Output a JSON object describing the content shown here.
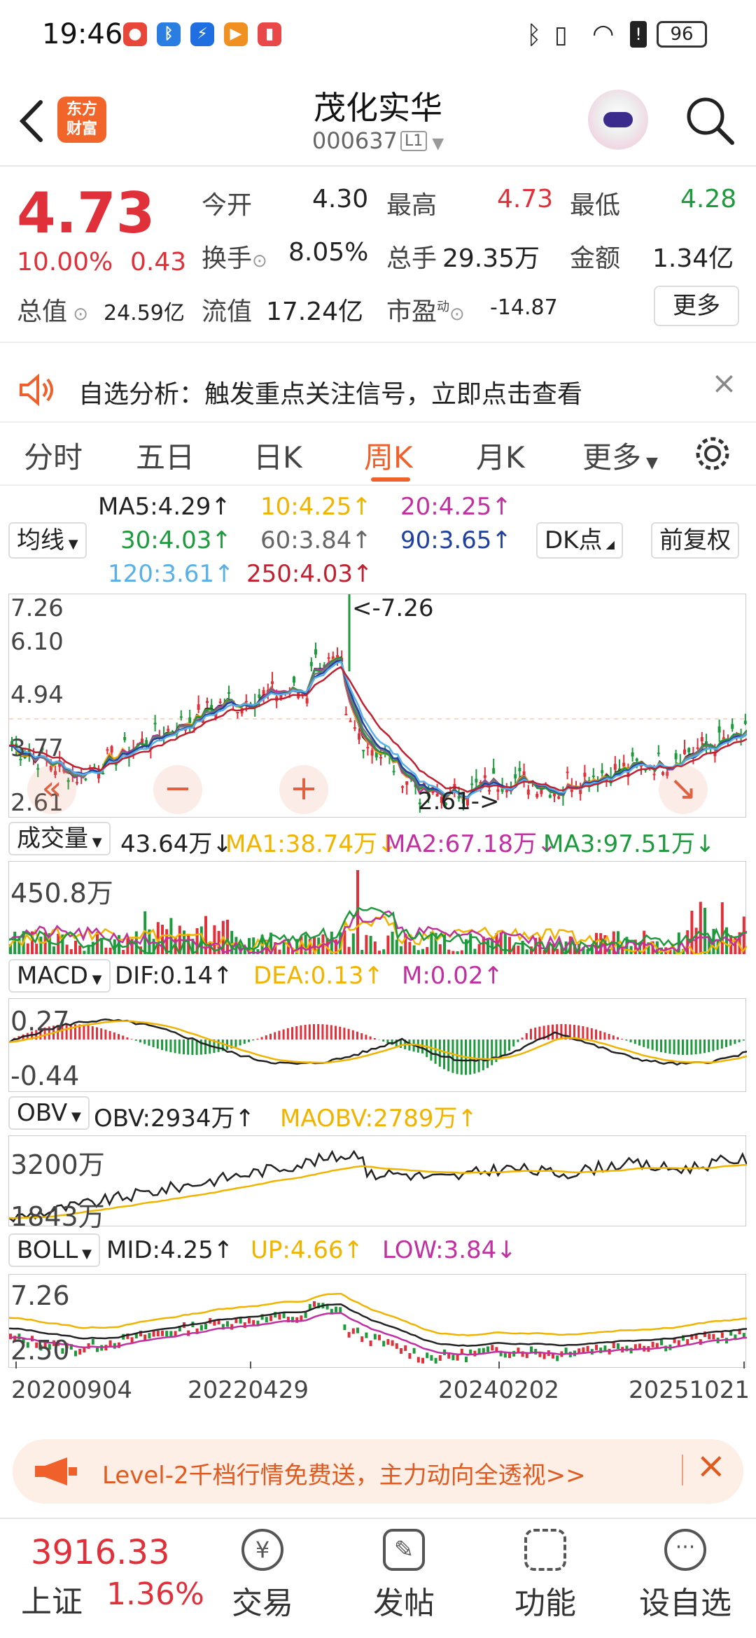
{
  "status": {
    "time": "19:46",
    "battery": "96"
  },
  "header": {
    "title": "茂化实华",
    "code": "000637",
    "badge": "L1",
    "logo_line1": "东方",
    "logo_line2": "财富"
  },
  "quote": {
    "price": "4.73",
    "change_pct": "10.00%",
    "change": "0.43",
    "open_label": "今开",
    "open": "4.30",
    "high_label": "最高",
    "high": "4.73",
    "low_label": "最低",
    "low": "4.28",
    "turnover_label": "换手",
    "turnover": "8.05%",
    "volume_label": "总手",
    "volume": "29.35万",
    "amount_label": "金额",
    "amount": "1.34亿",
    "mktcap_label": "总值",
    "mktcap": "24.59亿",
    "float_label": "流值",
    "float": "17.24亿",
    "pe_label": "市盈",
    "pe_sup": "动",
    "pe": "-14.87",
    "more": "更多"
  },
  "notice": {
    "text": "自选分析：触发重点关注信号，立即点击查看"
  },
  "tabs": [
    "分时",
    "五日",
    "日K",
    "周K",
    "月K",
    "更多"
  ],
  "colors": {
    "up": "#e0303a",
    "down": "#1d9a3b",
    "accent": "#f0602a",
    "ma5": "#222222",
    "ma10": "#f0b400",
    "ma20": "#c030a0",
    "ma30": "#1d9a3b",
    "ma60": "#777777",
    "ma90": "#2040a0",
    "ma120": "#58b0e8",
    "ma250": "#c02030"
  },
  "ma_controls": {
    "select": "均线",
    "dk": "DK点",
    "fq": "前复权"
  },
  "ma": {
    "ma5": "MA5:4.29↑",
    "ma10": "10:4.25↑",
    "ma20": "20:4.25↑",
    "ma30": "30:4.03↑",
    "ma60": "60:3.84↑",
    "ma90": "90:3.65↑",
    "ma120": "120:3.61↑",
    "ma250": "250:4.03↑"
  },
  "main_chart": {
    "y_ticks": [
      "7.26",
      "6.10",
      "4.94",
      "3.77",
      "2.61"
    ],
    "high_note": "<-7.26",
    "low_note": "2.61->"
  },
  "volume_panel": {
    "select": "成交量",
    "value": "43.64万↓",
    "ma1": "MA1:38.74万↓",
    "ma2": "MA2:67.18万↓",
    "ma3": "MA3:97.51万↓",
    "max": "450.8万"
  },
  "macd_panel": {
    "select": "MACD",
    "dif": "DIF:0.14↑",
    "dea": "DEA:0.13↑",
    "m": "M:0.02↑",
    "top": "0.27",
    "bottom": "-0.44"
  },
  "obv_panel": {
    "select": "OBV",
    "obv": "OBV:2934万↑",
    "maobv": "MAOBV:2789万↑",
    "top": "3200万",
    "bottom": "1843万"
  },
  "boll_panel": {
    "select": "BOLL",
    "mid": "MID:4.25↑",
    "up": "UP:4.66↑",
    "low": "LOW:3.84↓",
    "top": "7.26",
    "bottom": "2.50"
  },
  "dates": [
    "20200904",
    "20220429",
    "20240202",
    "20251021"
  ],
  "ad": {
    "text": "Level-2千档行情免费送，主力动向全透视>>"
  },
  "bottom": {
    "index_value": "3916.33",
    "index_name": "上证",
    "index_pct": "1.36%",
    "items": [
      "交易",
      "发帖",
      "功能",
      "设自选"
    ]
  }
}
